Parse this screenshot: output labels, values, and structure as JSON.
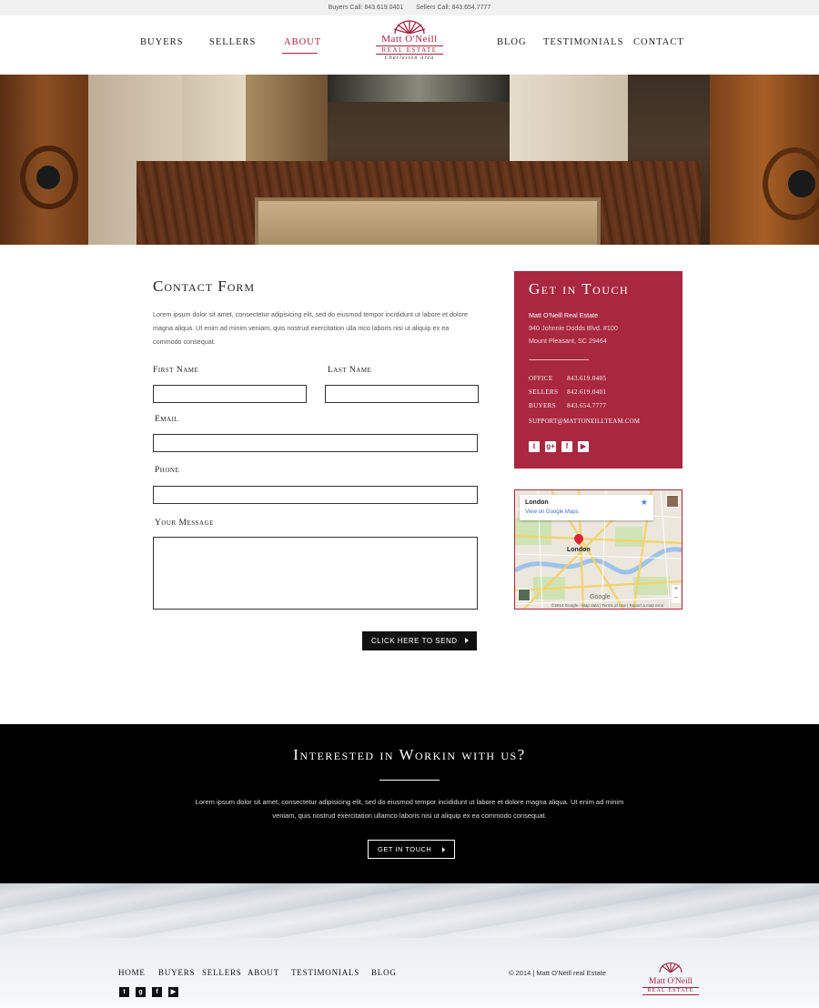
{
  "topbar": {
    "buyers": "Buyers Call: 843.619.0401",
    "sellers": "Sellers Call: 843.654.7777"
  },
  "nav": {
    "left": [
      "BUYERS",
      "SELLERS",
      "ABOUT"
    ],
    "right": [
      "BLOG",
      "TESTIMONIALS",
      "CONTACT"
    ],
    "active": "ABOUT"
  },
  "logo": {
    "name": "Matt O'Neill",
    "sub": "REAL ESTATE",
    "area": "Charleston Area"
  },
  "form": {
    "title": "Contact Form",
    "intro": "Lorem ipsum dolor sit amet, consectetur adipisicing elit, sed do eiusmod tempor incididunt ut labore et dolore magna aliqua. Ut enim ad minim veniam, quis nostrud exercitation ulla mco laboris nisi ut aliquip ex ea commodo consequat.",
    "first_name_label": "First Name",
    "last_name_label": "Last Name",
    "email_label": "Email",
    "phone_label": "Phone",
    "message_label": "Your Message",
    "first_name_value": "",
    "last_name_value": "",
    "email_value": "",
    "phone_value": "",
    "message_value": "",
    "send_label": "Click here to send"
  },
  "contact": {
    "title": "Get in Touch",
    "company": "Matt O'Neill Real Estate",
    "address1": "940 Johnnie Dodds Blvd. #100",
    "address2": "Mount Pleasant, SC 29464",
    "phones": [
      {
        "label": "Office",
        "number": "843.619.0405"
      },
      {
        "label": "Sellers",
        "number": "842.619.0401"
      },
      {
        "label": "Buyers",
        "number": "843.654.7777"
      }
    ],
    "email": "support@MattONeillTeam.com",
    "social": [
      "twitter-icon",
      "google-plus-icon",
      "facebook-icon",
      "youtube-icon"
    ]
  },
  "map": {
    "place": "London",
    "link": "View on Google Maps",
    "city_label": "London",
    "google": "Google",
    "attribution": "©2014 Google - Map data | Terms of Use | Report a map error"
  },
  "cta": {
    "title": "Interested in Workin with us?",
    "text": "Lorem ipsum dolor sit amet, consectetur adipisicing elit, sed do eiusmod tempor incididunt ut labore et dolore magna aliqua. Ut enim ad minim veniam, quis nostrud exercitation ullamco laboris nisi ut aliquip ex ea commodo consequat.",
    "button": "Get in Touch"
  },
  "footer": {
    "nav": [
      "HOME",
      "BUYERS",
      "SELLERS",
      "ABOUT",
      "TESTIMONIALS",
      "BLOG"
    ],
    "copyright": "© 2014 | Matt O'Neill real Estate",
    "logo_name": "Matt O'Neill",
    "logo_sub": "REAL ESTATE"
  },
  "colors": {
    "accent": "#a9273f",
    "dark": "#000000"
  }
}
